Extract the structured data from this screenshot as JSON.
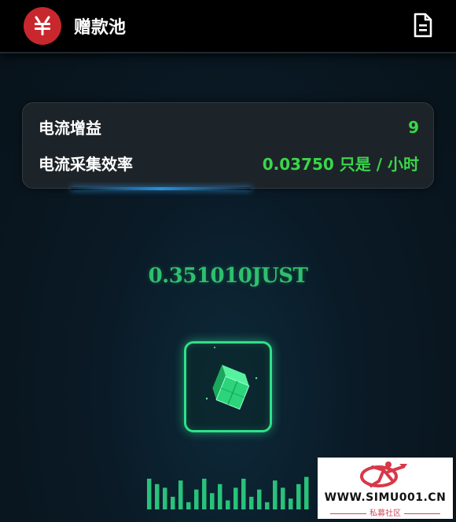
{
  "header": {
    "title": "赠款池",
    "logo_icon": "just-logo-icon",
    "doc_icon": "document-icon",
    "logo_color": "#c8282d"
  },
  "stats": {
    "gain_label": "电流增益",
    "gain_value": "9",
    "rate_label": "电流采集效率",
    "rate_value": "0.03750 只是 / 小时",
    "value_color": "#3ad64a"
  },
  "balance": {
    "text": "0.351010JUST",
    "color": "#2fc06e"
  },
  "mine_button": {
    "icon": "green-cube-icon",
    "border_color": "#2fe08a"
  },
  "equalizer": {
    "icon": "equalizer-bars-icon",
    "levels": [
      0.85,
      0.7,
      0.6,
      0.35,
      0.8,
      0.2,
      0.55,
      0.85,
      0.45,
      0.7,
      0.25,
      0.6,
      0.85,
      0.35,
      0.55,
      0.2,
      0.8,
      0.6,
      0.3,
      0.7,
      0.9
    ]
  },
  "watermark": {
    "text": "WWW.SIMU001.CN",
    "subtext": "私募社区",
    "logo_icon": "running-figure-logo-icon"
  }
}
